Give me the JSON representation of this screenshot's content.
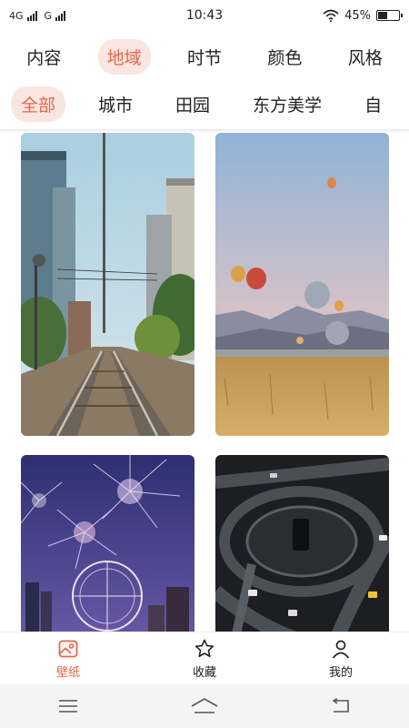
{
  "status_bar": {
    "network_1": "4G",
    "network_2": "G",
    "time": "10:43",
    "battery_percent": "45%",
    "battery_level": 0.45
  },
  "category_tabs": [
    {
      "label": "内容",
      "active": false
    },
    {
      "label": "地域",
      "active": true
    },
    {
      "label": "时节",
      "active": false
    },
    {
      "label": "颜色",
      "active": false
    },
    {
      "label": "风格",
      "active": false
    }
  ],
  "sub_tabs": [
    {
      "label": "全部",
      "active": true
    },
    {
      "label": "城市",
      "active": false
    },
    {
      "label": "田园",
      "active": false
    },
    {
      "label": "东方美学",
      "active": false
    },
    {
      "label": "自",
      "active": false
    }
  ],
  "wallpapers": [
    {
      "icon": "railway-photo"
    },
    {
      "icon": "hot-air-balloons-photo"
    },
    {
      "icon": "fireworks-ferris-wheel-photo"
    },
    {
      "icon": "highway-interchange-photo"
    }
  ],
  "bottom_nav": [
    {
      "label": "壁纸",
      "icon": "image-icon",
      "active": true
    },
    {
      "label": "收藏",
      "icon": "star-icon",
      "active": false
    },
    {
      "label": "我的",
      "icon": "person-icon",
      "active": false
    }
  ],
  "colors": {
    "accent": "#e5664a",
    "accent_bg": "#f8e6e1"
  }
}
